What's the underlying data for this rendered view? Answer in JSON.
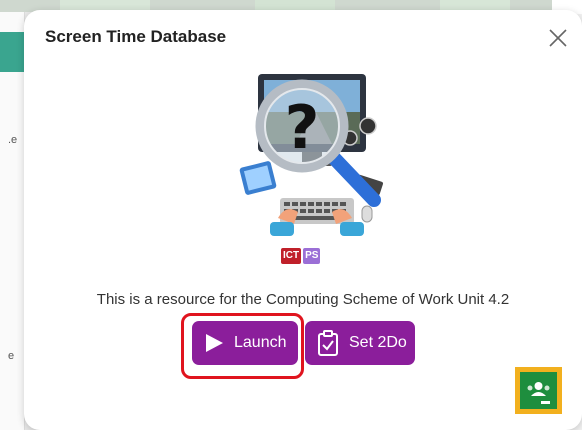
{
  "modal": {
    "title": "Screen Time Database",
    "description": "This is a resource for the Computing Scheme of Work Unit 4.2",
    "badges": [
      "ICT",
      "PS"
    ],
    "buttons": {
      "launch_label": "Launch",
      "set2do_label": "Set 2Do"
    },
    "icons": {
      "close": "close-icon",
      "launch": "play-icon",
      "set2do": "clipboard-check-icon",
      "classroom": "google-classroom-icon",
      "hero": "magnifier-question-computer-illustration"
    }
  },
  "background": {
    "fragments": [
      ".e",
      "e"
    ]
  },
  "colors": {
    "button": "#8b1e9b",
    "highlight": "#e0141e",
    "classroom_border": "#f2b01e",
    "classroom_fill": "#1e8e3e",
    "ict_badge": "#c0202a",
    "ps_badge": "#9b6fd6"
  }
}
